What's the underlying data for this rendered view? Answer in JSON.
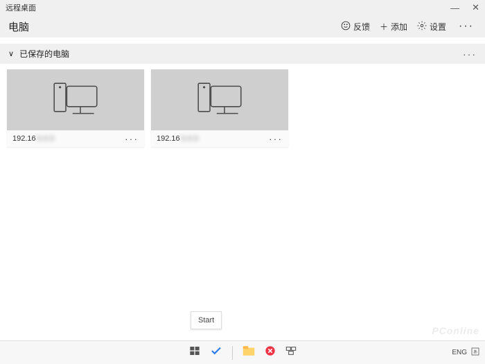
{
  "titlebar": {
    "app_title": "远程桌面"
  },
  "header": {
    "title": "电脑",
    "feedback_label": "反馈",
    "add_label": "添加",
    "settings_label": "设置"
  },
  "group": {
    "title": "已保存的电脑"
  },
  "cards": [
    {
      "ip": "192.16",
      "ip_suffix_blur": "0.0.0"
    },
    {
      "ip": "192.16",
      "ip_suffix_blur": "0.0.0"
    }
  ],
  "start_button": {
    "label": "Start"
  },
  "taskbar": {
    "lang": "ENG"
  },
  "watermark": {
    "text": "PConline"
  },
  "icons": {
    "minimize": "—",
    "close": "✕",
    "more": "···",
    "chevron_down": "∨",
    "plus": "＋"
  }
}
